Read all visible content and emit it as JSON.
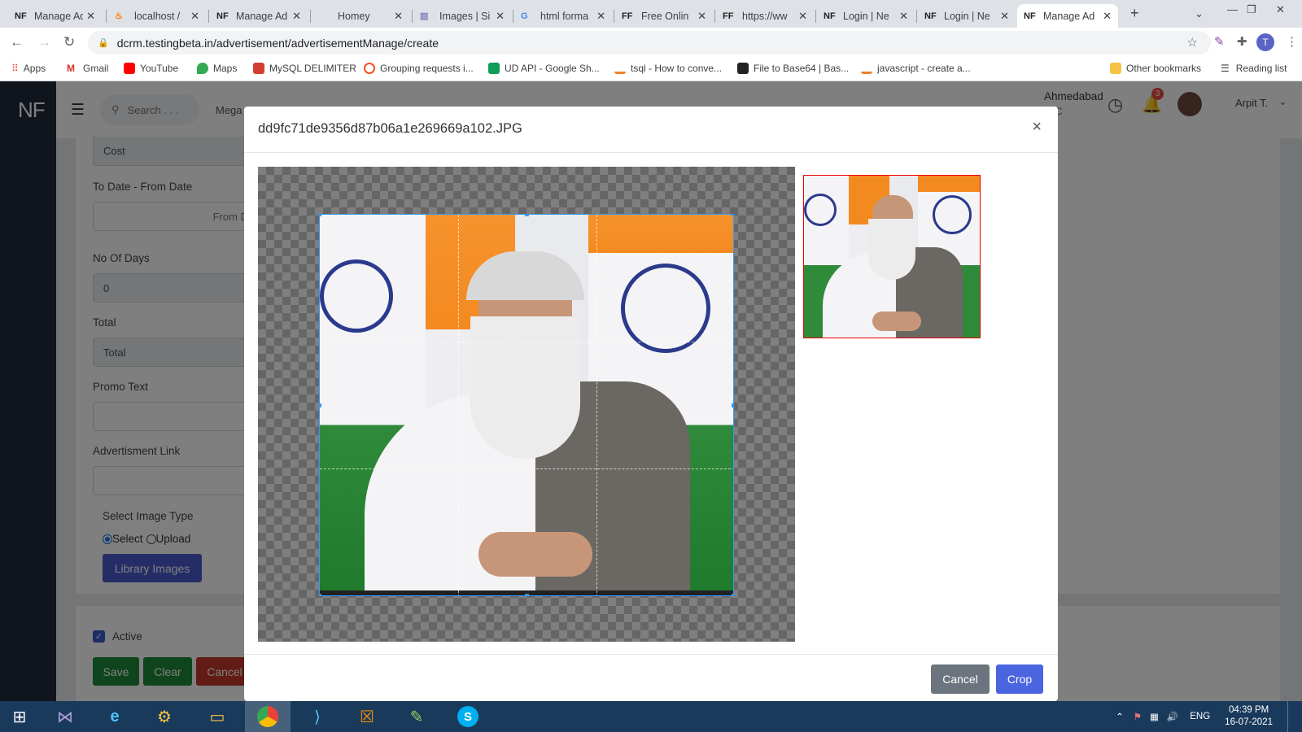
{
  "browser": {
    "tabs": [
      {
        "favicon": "NF",
        "title": "Manage Ad"
      },
      {
        "favicon": "xampp",
        "title": "localhost /"
      },
      {
        "favicon": "NF",
        "title": "Manage Ad"
      },
      {
        "favicon": "",
        "title": "Homey"
      },
      {
        "favicon": "stripe",
        "title": "Images | Si"
      },
      {
        "favicon": "G",
        "title": "html forma"
      },
      {
        "favicon": "FF",
        "title": "Free Onlin"
      },
      {
        "favicon": "FF",
        "title": "https://ww"
      },
      {
        "favicon": "NF",
        "title": "Login | Ne"
      },
      {
        "favicon": "NF",
        "title": "Login | Ne"
      },
      {
        "favicon": "NF",
        "title": "Manage Ad"
      }
    ],
    "new_tab": "+",
    "url": "dcrm.testingbeta.in/advertisement/advertisementManage/create",
    "profile_initial": "T",
    "bookmarks": [
      {
        "label": "Apps",
        "color": "#ea4335"
      },
      {
        "label": "Gmail",
        "color": "#d93025"
      },
      {
        "label": "YouTube",
        "color": "#ff0000"
      },
      {
        "label": "Maps",
        "color": "#34a853"
      },
      {
        "label": "MySQL DELIMITER",
        "color": "#d23f31"
      },
      {
        "label": "Grouping requests i...",
        "color": "#f4511e"
      },
      {
        "label": "UD API - Google Sh...",
        "color": "#0f9d58"
      },
      {
        "label": "tsql - How to conve...",
        "color": "#f48024"
      },
      {
        "label": "File to Base64 | Bas...",
        "color": "#222222"
      },
      {
        "label": "javascript - create a...",
        "color": "#f48024"
      }
    ],
    "other_bookmarks": "Other bookmarks",
    "reading_list": "Reading list"
  },
  "app": {
    "logo": "NF",
    "search_placeholder": "Search . . .",
    "menu_partial": "Mega",
    "location": "Ahmedabad",
    "location_sub": "C",
    "notification_count": "3",
    "user_name": "Arpit T."
  },
  "form": {
    "cost_placeholder": "Cost",
    "date_label": "To Date - From Date",
    "date_placeholder": "From Date",
    "days_label": "No Of Days",
    "days_value": "0",
    "total_label": "Total",
    "total_placeholder": "Total",
    "promo_label": "Promo Text",
    "link_label": "Advertisment Link",
    "image_type_label": "Select Image Type",
    "radio_select": "Select",
    "radio_upload": "Upload",
    "library_button": "Library Images",
    "active_label": "Active",
    "save": "Save",
    "clear": "Clear",
    "cancel": "Cancel"
  },
  "modal": {
    "title": "dd9fc71de9356d87b06a1e269669a102.JPG",
    "close": "×",
    "cancel": "Cancel",
    "crop": "Crop"
  },
  "taskbar": {
    "language": "ENG",
    "time": "04:39 PM",
    "date": "16-07-2021"
  }
}
